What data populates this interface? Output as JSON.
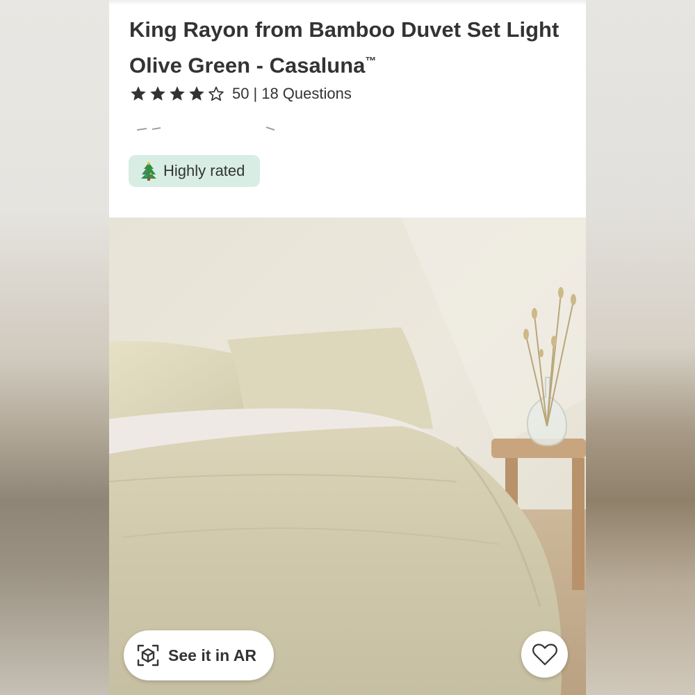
{
  "product": {
    "title": "King Rayon from Bamboo Duvet Set Light Olive Green - Casaluna",
    "trademark": "™",
    "rating": {
      "stars": 4,
      "max_stars": 5,
      "count": "50",
      "questions": "18 Questions",
      "separator": "|"
    }
  },
  "badge": {
    "icon": "christmas-tree-icon",
    "label": "Highly rated",
    "background": "#d8ede4"
  },
  "hero": {
    "ar_button_label": "See it in AR",
    "ar_icon": "ar-cube-icon",
    "favorite_icon": "heart-outline-icon"
  },
  "colors": {
    "text": "#333333",
    "star": "#333333",
    "accent_badge": "#d8ede4"
  }
}
